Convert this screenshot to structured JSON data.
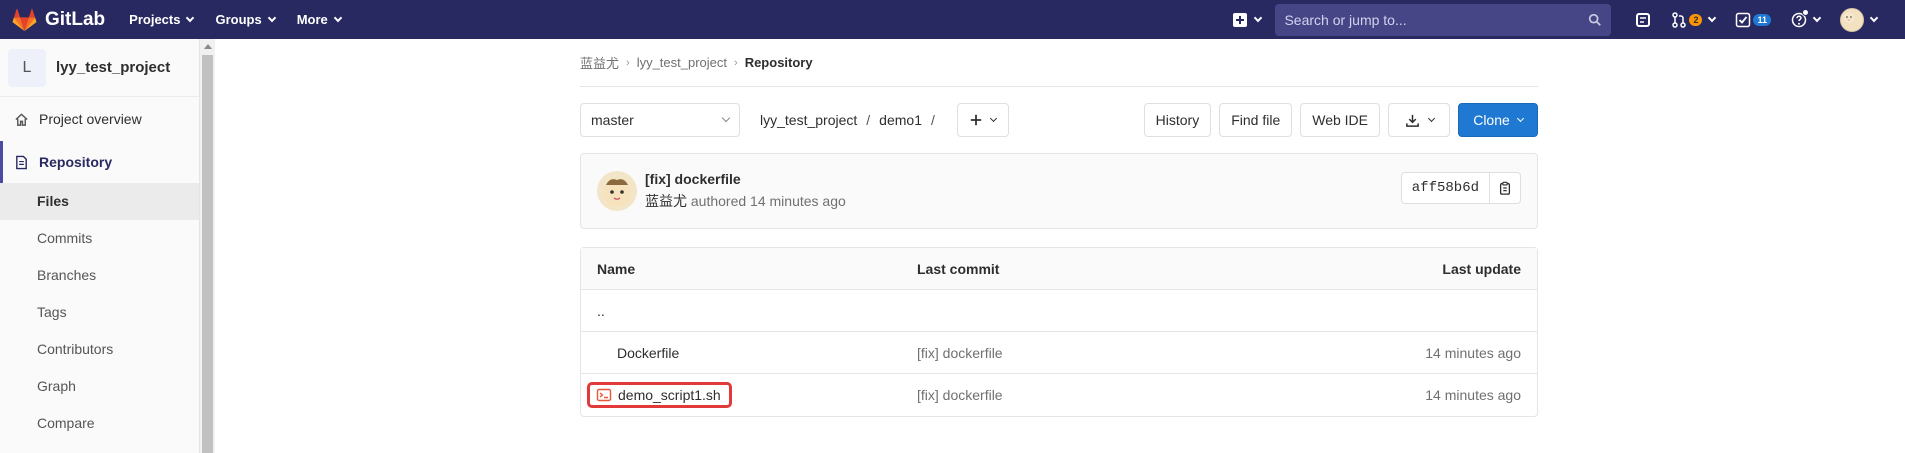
{
  "navbar": {
    "brand": "GitLab",
    "menus": [
      "Projects",
      "Groups",
      "More"
    ],
    "search_placeholder": "Search or jump to...",
    "merge_requests_count": "2",
    "todos_count": "11"
  },
  "sidebar": {
    "project_initial": "L",
    "project_name": "lyy_test_project",
    "overview": "Project overview",
    "repository": "Repository",
    "items": [
      "Files",
      "Commits",
      "Branches",
      "Tags",
      "Contributors",
      "Graph",
      "Compare"
    ]
  },
  "breadcrumb": {
    "user": "蓝益尤",
    "project": "lyy_test_project",
    "current": "Repository"
  },
  "tree_controls": {
    "branch": "master",
    "path_root": "lyy_test_project",
    "path_dir": "demo1",
    "history": "History",
    "find_file": "Find file",
    "web_ide": "Web IDE",
    "clone": "Clone"
  },
  "commit": {
    "title": "[fix] dockerfile",
    "author": "蓝益尤",
    "meta": "authored 14 minutes ago",
    "sha": "aff58b6d"
  },
  "table": {
    "headers": {
      "name": "Name",
      "last_commit": "Last commit",
      "last_update": "Last update"
    },
    "parent": "..",
    "rows": [
      {
        "name": "Dockerfile",
        "commit": "[fix] dockerfile",
        "update": "14 minutes ago"
      },
      {
        "name": "demo_script1.sh",
        "commit": "[fix] dockerfile",
        "update": "14 minutes ago"
      }
    ]
  },
  "colors": {
    "navbar_bg": "#292961",
    "primary": "#1f78d1",
    "highlight": "#e03a3a"
  }
}
